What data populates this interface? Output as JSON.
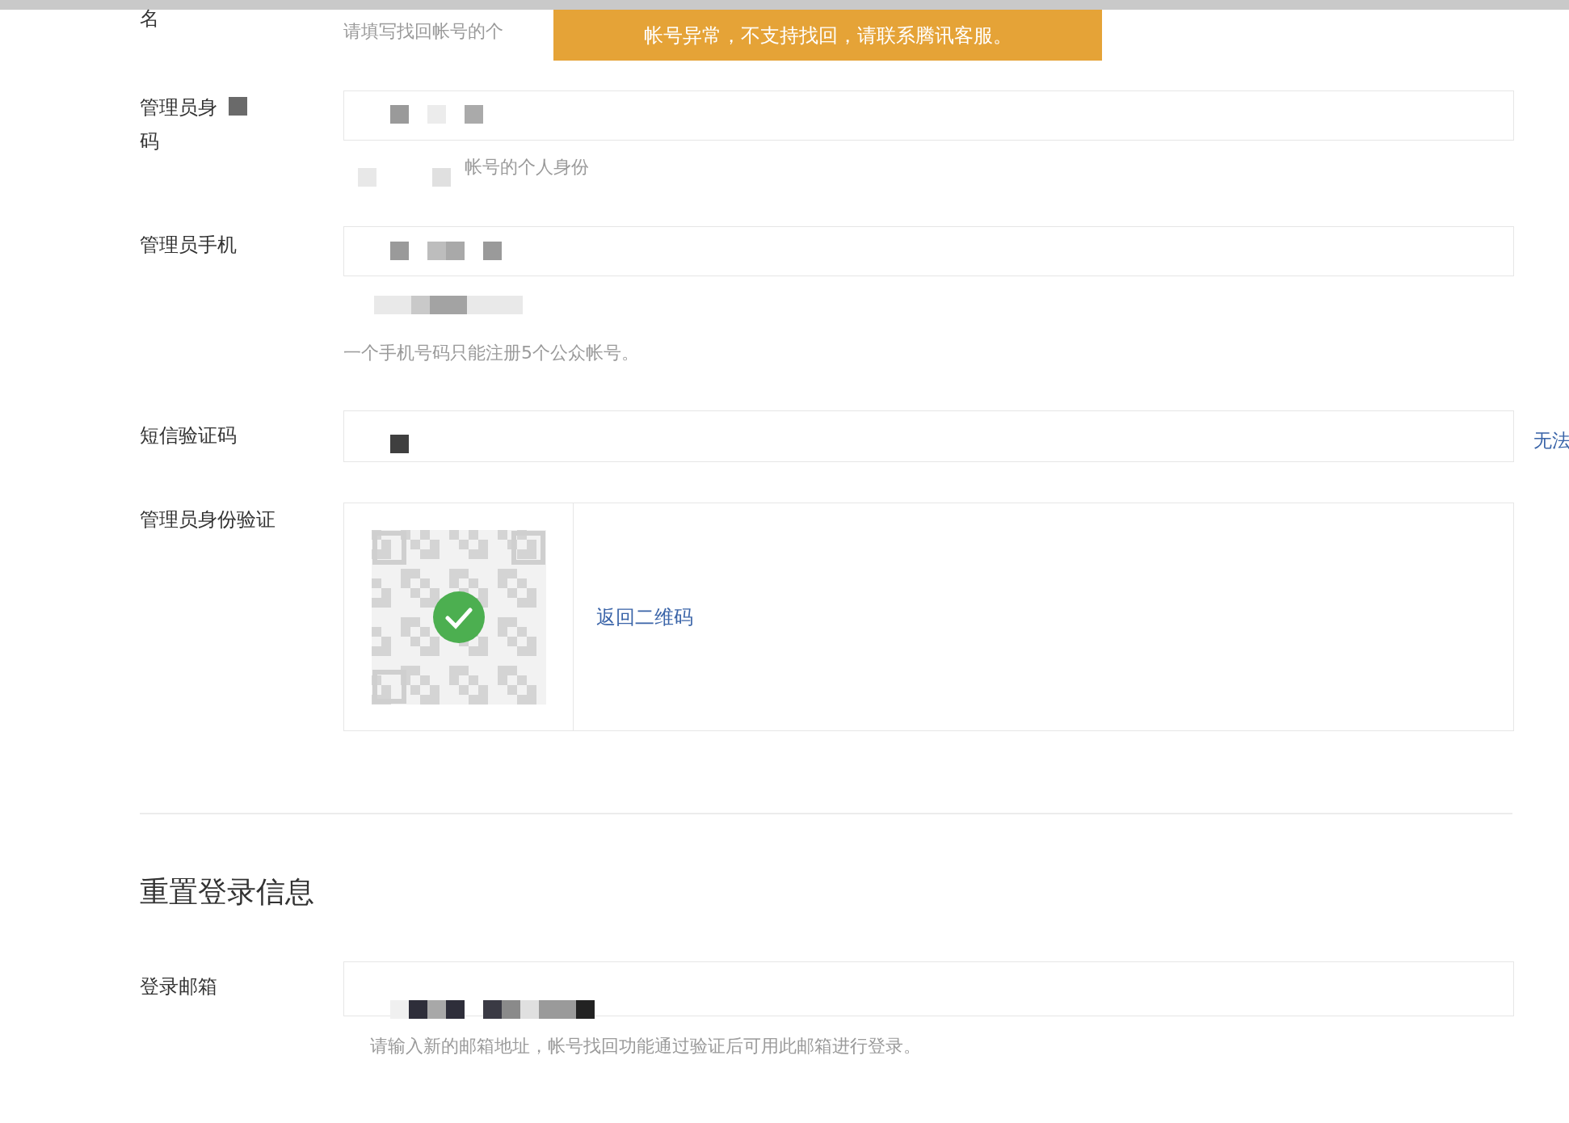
{
  "toast": {
    "text": "帐号异常，不支持找回，请联系腾讯客服。"
  },
  "name_row": {
    "label": "名",
    "hint": "请填写找回帐号的个"
  },
  "id_row": {
    "label_lines": [
      "管理员身",
      "码"
    ],
    "hint": "帐号的个人身份"
  },
  "phone_row": {
    "label": "管理员手机",
    "hint": "一个手机号码只能注册5个公众帐号。"
  },
  "sms_row": {
    "label": "短信验证码",
    "side_link": "无法"
  },
  "verify_row": {
    "label": "管理员身份验证",
    "link": "返回二维码",
    "verified": true
  },
  "section": {
    "title": "重置登录信息"
  },
  "email_row": {
    "label": "登录邮箱",
    "hint": "请输入新的邮箱地址，帐号找回功能通过验证后可用此邮箱进行登录。"
  }
}
